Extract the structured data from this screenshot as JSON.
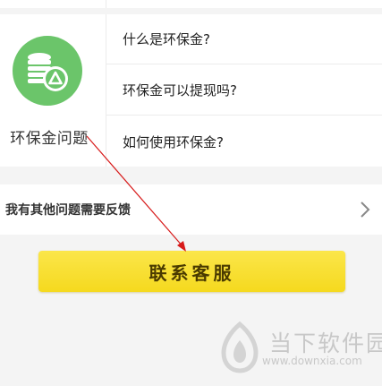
{
  "category": {
    "label": "环保金问题",
    "icon": "coins-recycle-icon",
    "icon_color": "#6bc56a"
  },
  "questions": [
    {
      "label": "什么是环保金?"
    },
    {
      "label": "环保金可以提现吗?"
    },
    {
      "label": "如何使用环保金?"
    }
  ],
  "feedback": {
    "label": "我有其他问题需要反馈",
    "icon": "chevron-right-icon"
  },
  "contact_button": {
    "label": "联系客服",
    "color": "#f7dc2a"
  },
  "annotation": {
    "icon": "red-arrow",
    "color": "#d71a1a"
  },
  "watermark": {
    "title": "当下软件园",
    "url": "www.downxia.com",
    "icon": "downxia-logo-icon"
  }
}
